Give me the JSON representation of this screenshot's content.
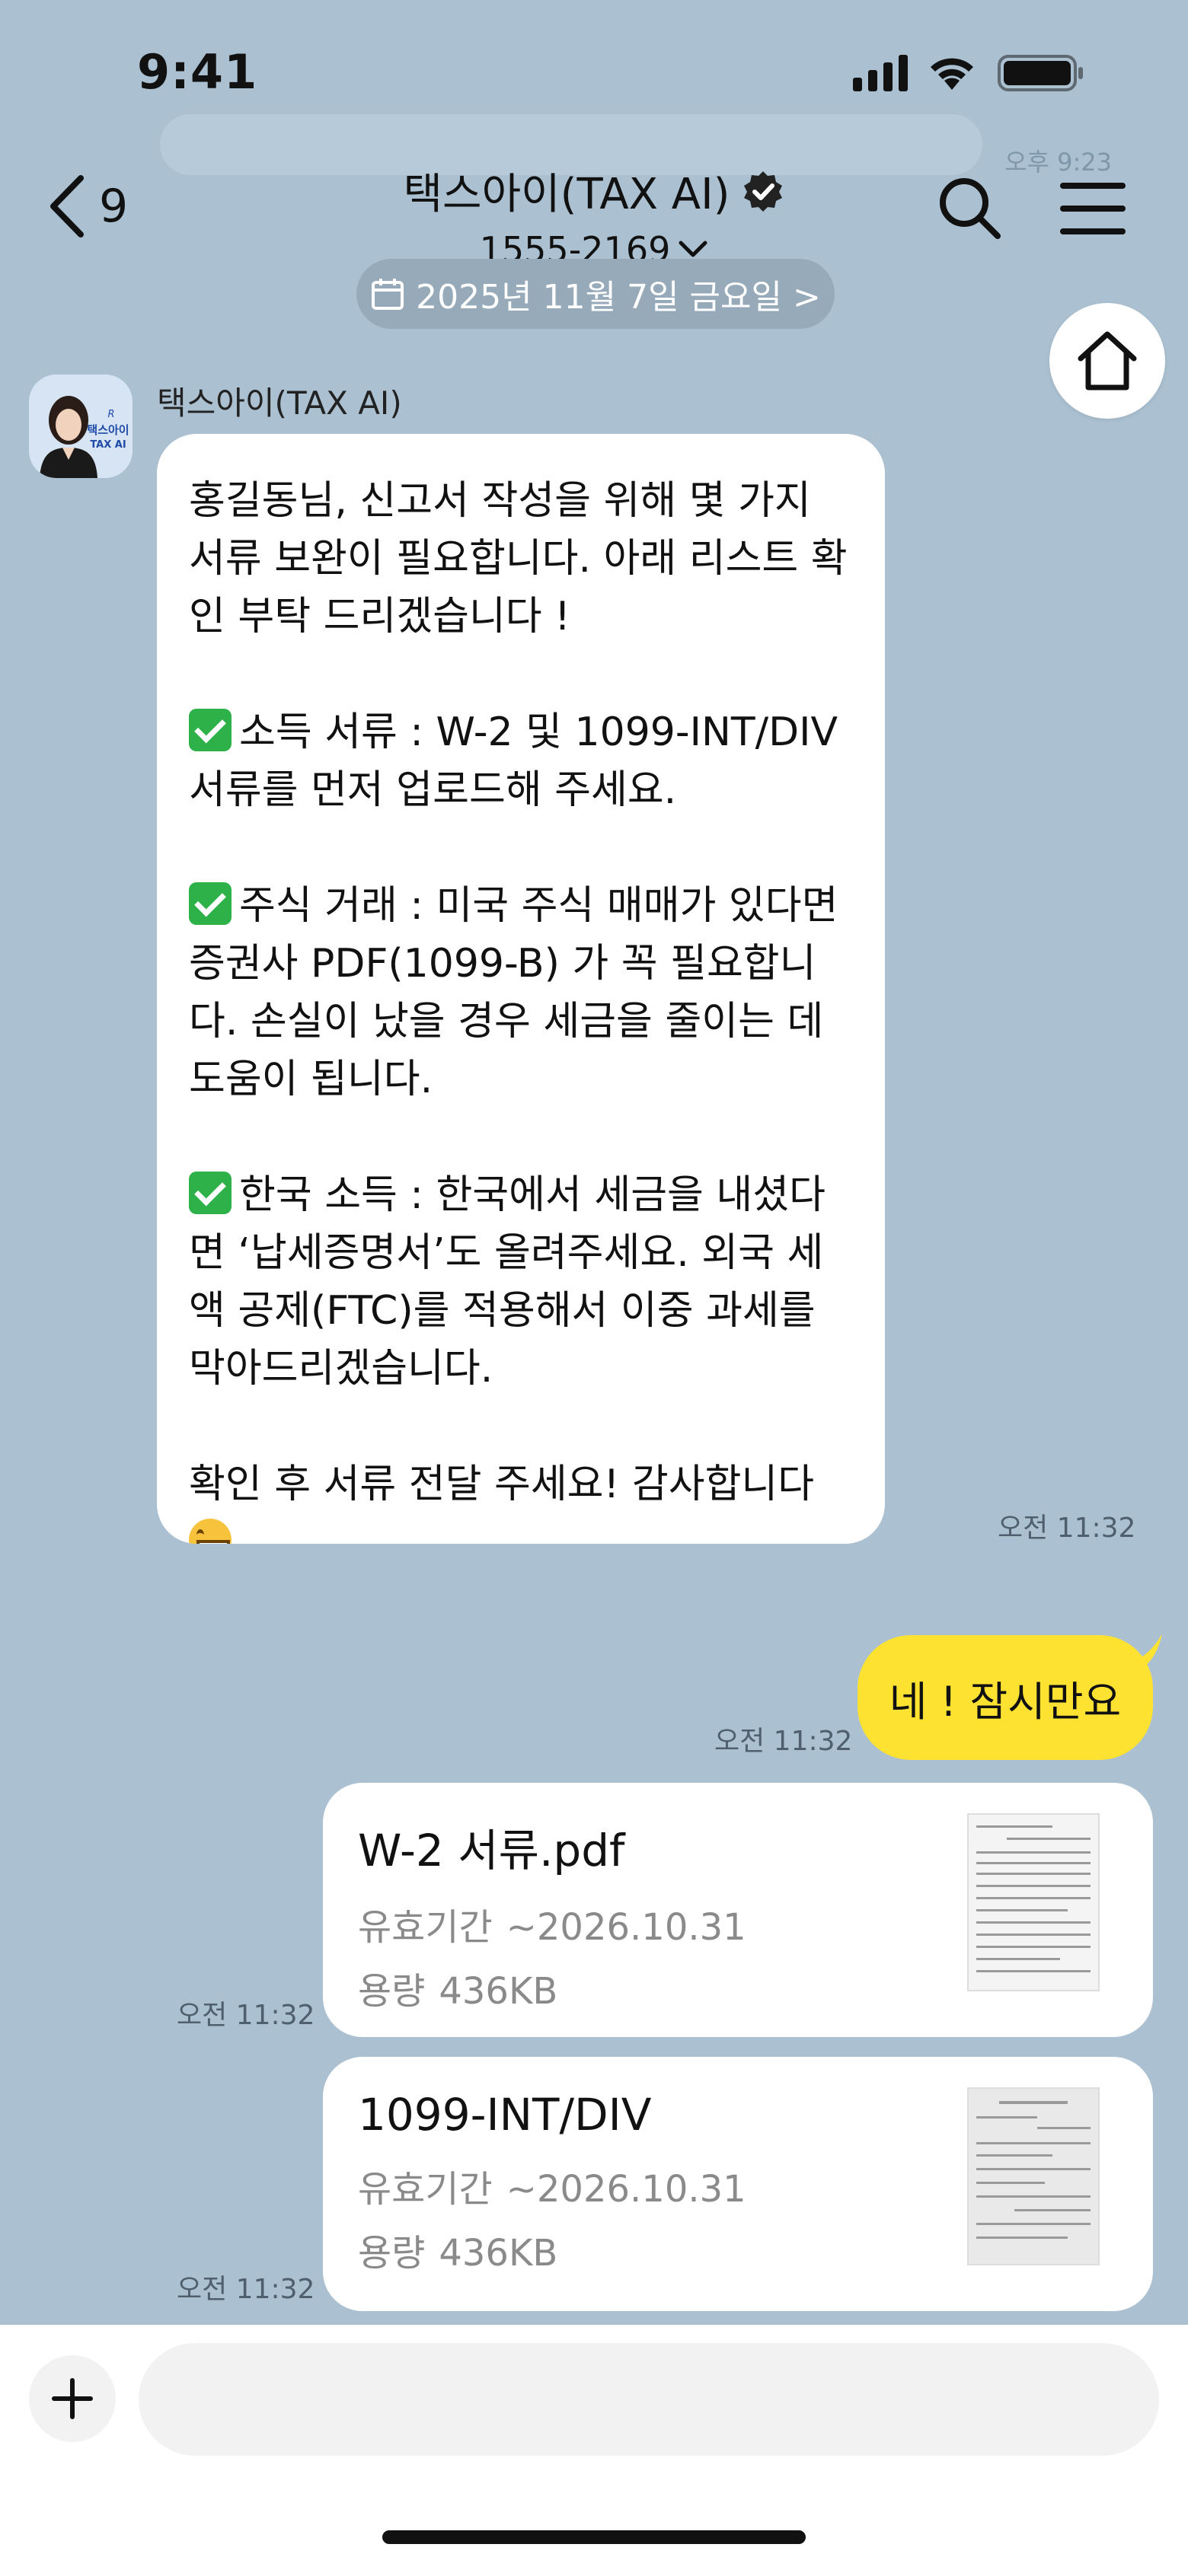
{
  "status_bar": {
    "time": "9:41"
  },
  "header": {
    "back_count": "9",
    "title": "택스아이(TAX AI)",
    "phone": "1555-2169",
    "ghost_time": "오후 9:23",
    "date_pill": "2025년 11월 7일 금요일 >"
  },
  "sender": {
    "name": "택스아이(TAX AI)",
    "avatar_text": "택스아이 TAX AI"
  },
  "bot_message": {
    "intro": "홍길동님, 신고서 작성을 위해 몇 가지 서류 보완이 필요합니다. 아래 리스트 확인 부탁 드리겠습니다 !",
    "item1": "소득 서류 : W-2 및 1099-INT/DIV 서류를 먼저 업로드해 주세요.",
    "item2": "주식 거래 : 미국 주식 매매가 있다면 증권사 PDF(1099-B) 가 꼭 필요합니다. 손실이 났을 경우 세금을 줄이는 데 도움이 됩니다.",
    "item3": "한국 소득 : 한국에서 세금을 내셨다면 ‘납세증명서’도 올려주세요. 외국 세액 공제(FTC)를 적용해서 이중 과세를 막아드리겠습니다.",
    "outro": "확인 후 서류 전달 주세요! 감사합니다",
    "time": "오전 11:32"
  },
  "user_message": {
    "text": "네 ! 잠시만요",
    "time": "오전 11:32"
  },
  "files": [
    {
      "name": "W-2 서류.pdf",
      "expiry_label": "유효기간",
      "expiry": "~2026.10.31",
      "size_label": "용량",
      "size": "436KB",
      "time": "오전 11:32"
    },
    {
      "name": "1099-INT/DIV",
      "expiry_label": "유효기간",
      "expiry": "~2026.10.31",
      "size_label": "용량",
      "size": "436KB",
      "time": "오전 11:32"
    }
  ],
  "input": {
    "placeholder": ""
  },
  "colors": {
    "background": "#abc1d1",
    "user_bubble": "#fde232",
    "verified": "#222222"
  }
}
